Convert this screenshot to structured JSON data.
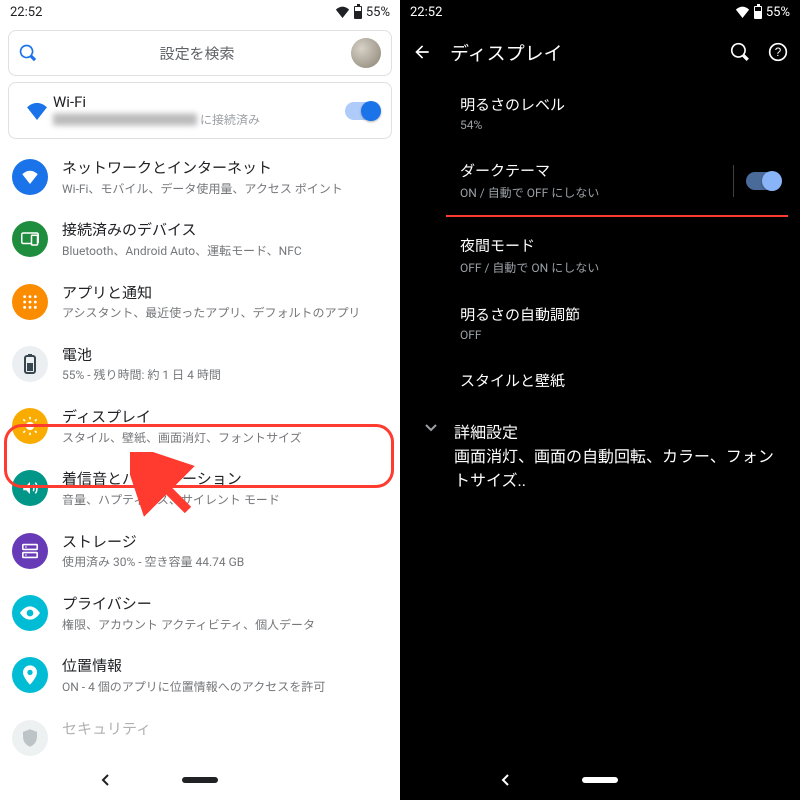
{
  "left": {
    "status": {
      "time": "22:52",
      "battery": "55%"
    },
    "search": {
      "placeholder": "設定を検索"
    },
    "wifi": {
      "title": "Wi-Fi",
      "name_redacted": "████████████",
      "suffix": " に接続済み"
    },
    "items": [
      {
        "title": "ネットワークとインターネット",
        "sub": "Wi-Fi、モバイル、データ使用量、アクセス ポイント"
      },
      {
        "title": "接続済みのデバイス",
        "sub": "Bluetooth、Android Auto、運転モード、NFC"
      },
      {
        "title": "アプリと通知",
        "sub": "アシスタント、最近使ったアプリ、デフォルトのアプリ"
      },
      {
        "title": "電池",
        "sub": "55% - 残り時間: 約 1 日 4 時間"
      },
      {
        "title": "ディスプレイ",
        "sub": "スタイル、壁紙、画面消灯、フォントサイズ"
      },
      {
        "title": "着信音とバイブレーション",
        "sub": "音量、ハプティクス、サイレント モード"
      },
      {
        "title": "ストレージ",
        "sub": "使用済み 30% - 空き容量 44.74 GB"
      },
      {
        "title": "プライバシー",
        "sub": "権限、アカウント アクティビティ、個人データ"
      },
      {
        "title": "位置情報",
        "sub": "ON - 4 個のアプリに位置情報へのアクセスを許可"
      },
      {
        "title": "セキュリティ",
        "sub": ""
      }
    ]
  },
  "right": {
    "status": {
      "time": "22:52",
      "battery": "55%"
    },
    "title": "ディスプレイ",
    "items": {
      "brightness": {
        "t": "明るさのレベル",
        "s": "54%"
      },
      "dark": {
        "t": "ダークテーマ",
        "s": "ON / 自動で OFF にしない"
      },
      "night": {
        "t": "夜間モード",
        "s": "OFF / 自動で ON にしない"
      },
      "auto": {
        "t": "明るさの自動調節",
        "s": "OFF"
      },
      "style": {
        "t": "スタイルと壁紙"
      },
      "advanced": {
        "t": "詳細設定",
        "s": "画面消灯、画面の自動回転、カラー、フォントサイズ.."
      }
    }
  }
}
